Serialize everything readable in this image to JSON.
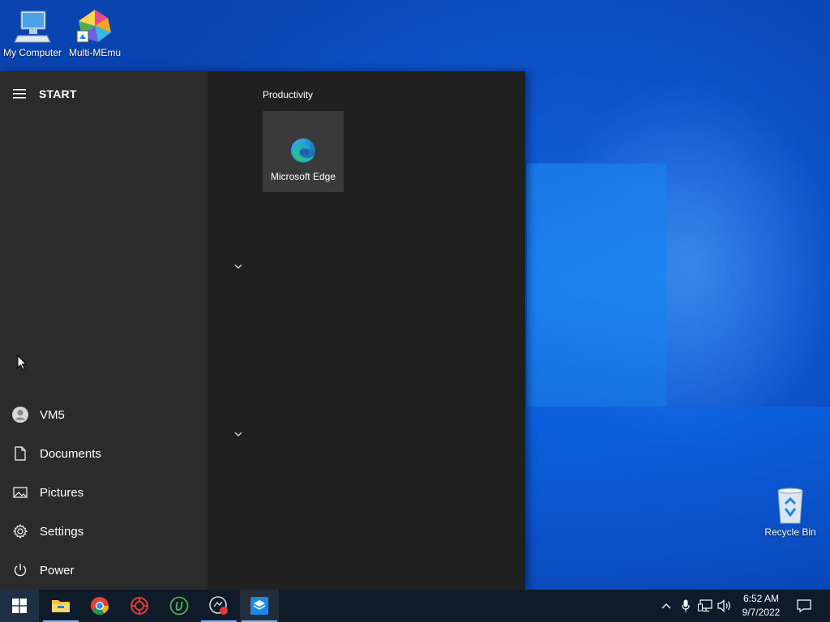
{
  "desktop": {
    "icons": [
      {
        "label": "My Computer",
        "icon": "computer-icon"
      },
      {
        "label": "Multi-MEmu",
        "icon": "multi-memu-icon"
      },
      {
        "label": "Recycle Bin",
        "icon": "recycle-bin-icon"
      }
    ]
  },
  "start_menu": {
    "title": "START",
    "left_items": [
      {
        "label": "VM5",
        "icon": "user-avatar-icon"
      },
      {
        "label": "Documents",
        "icon": "document-icon"
      },
      {
        "label": "Pictures",
        "icon": "pictures-icon"
      },
      {
        "label": "Settings",
        "icon": "gear-icon"
      },
      {
        "label": "Power",
        "icon": "power-icon"
      }
    ],
    "group": {
      "label": "Productivity",
      "tiles": [
        {
          "label": "Microsoft Edge",
          "icon": "edge-icon"
        }
      ]
    }
  },
  "taskbar": {
    "apps": [
      {
        "name": "File Explorer",
        "icon": "file-explorer-icon"
      },
      {
        "name": "Google Chrome",
        "icon": "chrome-icon"
      },
      {
        "name": "App",
        "icon": "red-gear-icon"
      },
      {
        "name": "uTorrent",
        "icon": "utorrent-icon"
      },
      {
        "name": "Recorder",
        "icon": "record-icon"
      },
      {
        "name": "App",
        "icon": "box-icon"
      }
    ],
    "clock": {
      "time": "6:52 AM",
      "date": "9/7/2022"
    }
  },
  "colors": {
    "start_left": "#2b2b2b",
    "start_right": "#202020",
    "tile": "#3a3a3a",
    "taskbar": "#101b2a",
    "wallpaper": "#0d55cc"
  }
}
